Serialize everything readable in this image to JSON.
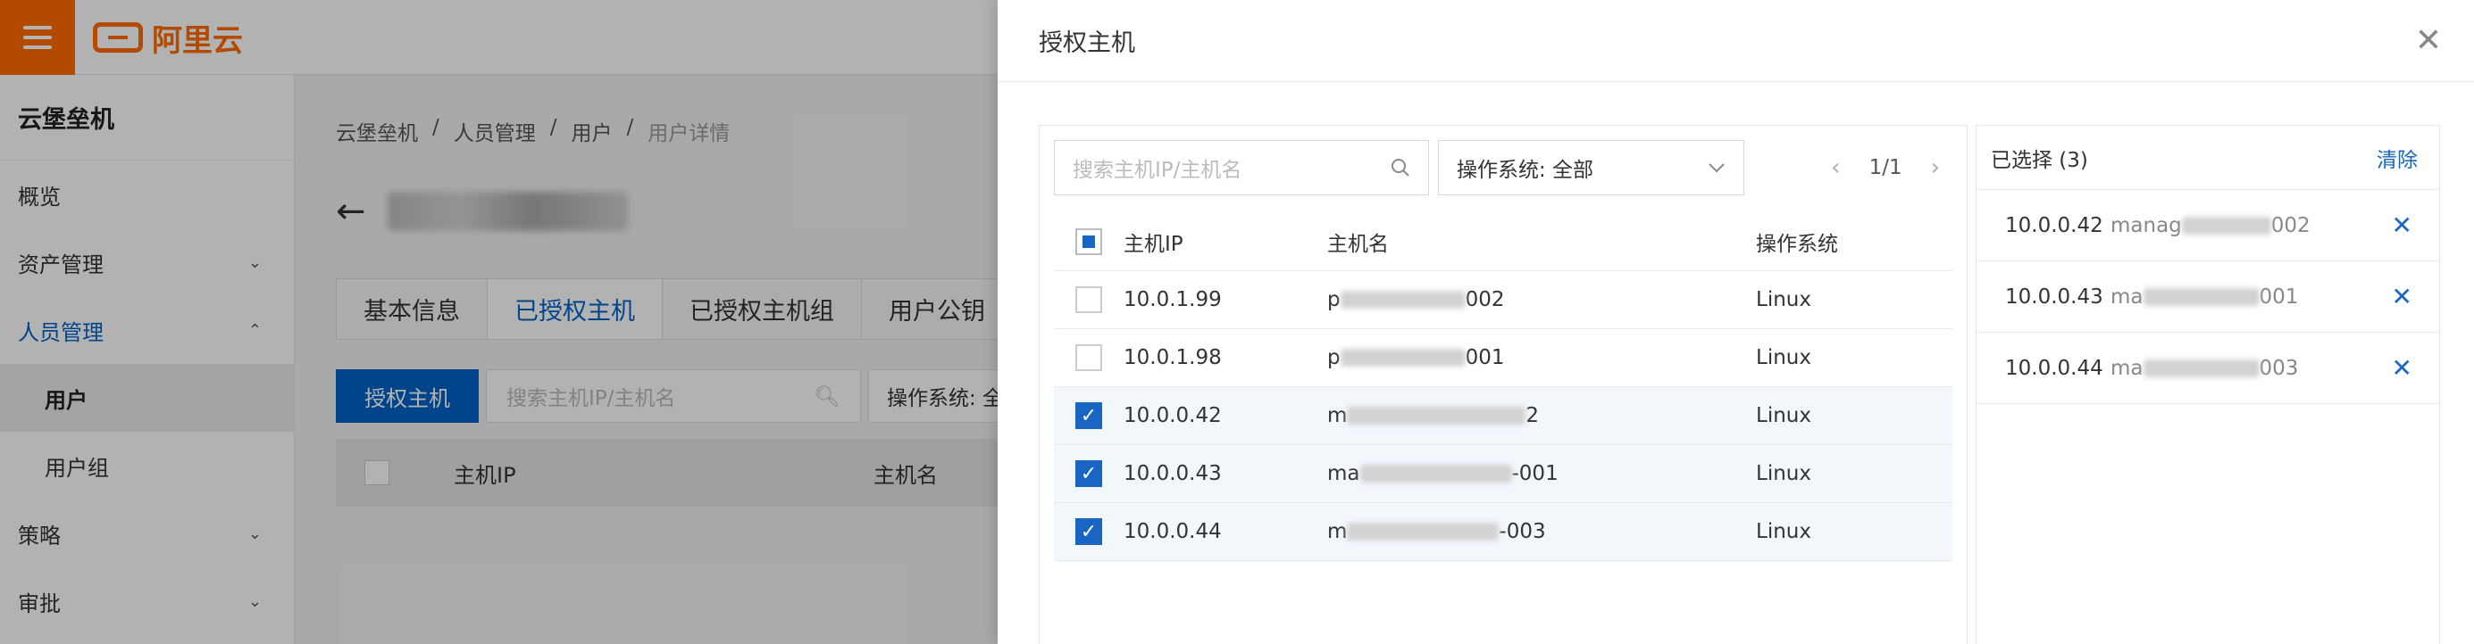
{
  "logo": {
    "text": "阿里云"
  },
  "sidebar": {
    "title": "云堡垒机",
    "items": [
      {
        "label": "概览",
        "chevron": ""
      },
      {
        "label": "资产管理",
        "chevron": "⌄"
      },
      {
        "label": "人员管理",
        "chevron": "⌃"
      },
      {
        "label": "用户",
        "chevron": ""
      },
      {
        "label": "用户组",
        "chevron": ""
      },
      {
        "label": "策略",
        "chevron": "⌄"
      },
      {
        "label": "审批",
        "chevron": "⌄"
      }
    ]
  },
  "breadcrumb": [
    "云堡垒机",
    "/",
    "人员管理",
    "/",
    "用户",
    "/",
    "用户详情"
  ],
  "tabs": [
    "基本信息",
    "已授权主机",
    "已授权主机组",
    "用户公钥"
  ],
  "page_toolbar": {
    "auth_button": "授权主机",
    "search_placeholder": "搜索主机IP/主机名",
    "os_filter": "操作系统: 全"
  },
  "page_table": {
    "col_ip": "主机IP",
    "col_name": "主机名"
  },
  "drawer": {
    "title": "授权主机",
    "search_placeholder": "搜索主机IP/主机名",
    "os_select": "操作系统: 全部",
    "pager": "1/1",
    "columns": {
      "ip": "主机IP",
      "name": "主机名",
      "os": "操作系统"
    },
    "rows": [
      {
        "ip": "10.0.1.99",
        "name_prefix": "p",
        "name_suffix": "002",
        "os": "Linux",
        "checked": false
      },
      {
        "ip": "10.0.1.98",
        "name_prefix": "p",
        "name_suffix": "001",
        "os": "Linux",
        "checked": false
      },
      {
        "ip": "10.0.0.42",
        "name_prefix": "m",
        "name_suffix": "2",
        "os": "Linux",
        "checked": true
      },
      {
        "ip": "10.0.0.43",
        "name_prefix": "ma",
        "name_suffix": "-001",
        "os": "Linux",
        "checked": true
      },
      {
        "ip": "10.0.0.44",
        "name_prefix": "m",
        "name_suffix": "-003",
        "os": "Linux",
        "checked": true
      }
    ],
    "selected": {
      "title": "已选择 (3)",
      "clear": "清除",
      "items": [
        {
          "ip": "10.0.0.42",
          "name_prefix": "manag",
          "name_suffix": "002"
        },
        {
          "ip": "10.0.0.43",
          "name_prefix": "ma",
          "name_suffix": "001"
        },
        {
          "ip": "10.0.0.44",
          "name_prefix": "ma",
          "name_suffix": "003"
        }
      ]
    }
  }
}
